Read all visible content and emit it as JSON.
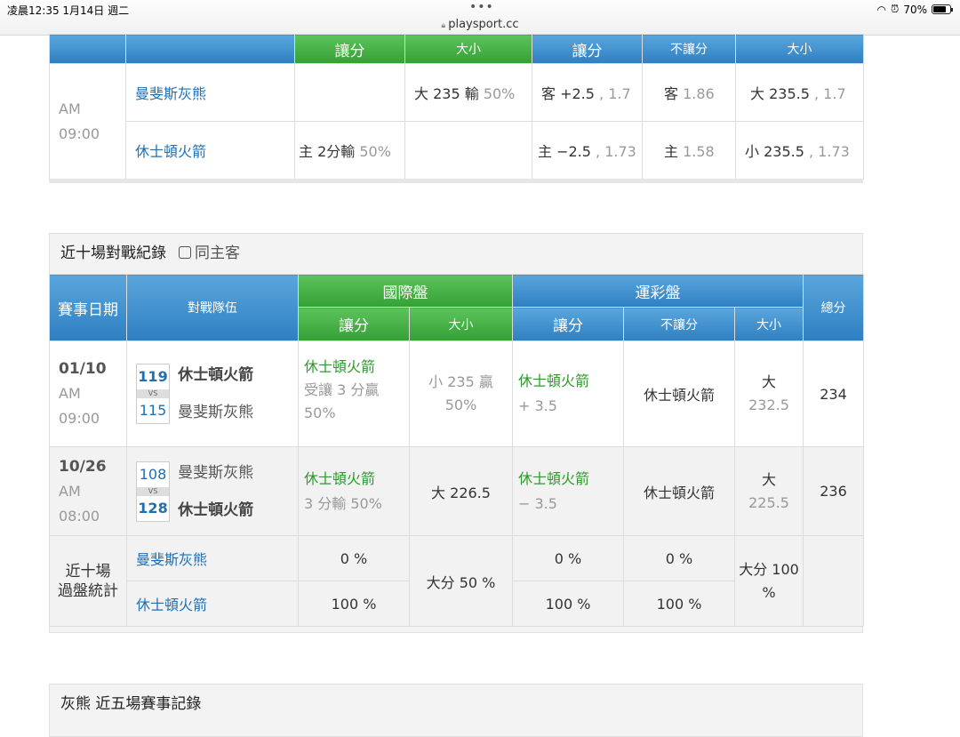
{
  "status": {
    "time": "凌晨12:35 1月14日 週二",
    "url": "playsport.cc",
    "battery": "70%",
    "dots": "•••"
  },
  "top_table": {
    "headers": {
      "intl_spread": "讓分",
      "intl_ou": "大小",
      "lot_spread": "讓分",
      "lot_nospread": "不讓分",
      "lot_ou": "大小"
    },
    "time": "AM 09:00",
    "rows": [
      {
        "team": "曼斐斯灰熊",
        "intl_spread": "",
        "intl_ou_main": "大 235 輸",
        "intl_ou_pct": "50%",
        "lot_spread_main": "客 +2.5",
        "lot_spread_odds": ", 1.7",
        "lot_nospread_main": "客",
        "lot_nospread_odds": "1.86",
        "lot_ou_main": "大 235.5",
        "lot_ou_odds": ", 1.7"
      },
      {
        "team": "休士頓火箭",
        "intl_spread_main": "主 2分輸",
        "intl_spread_pct": "50%",
        "intl_ou": "",
        "lot_spread_main": "主 −2.5",
        "lot_spread_odds": ", 1.73",
        "lot_nospread_main": "主",
        "lot_nospread_odds": "1.58",
        "lot_ou_main": "小 235.5",
        "lot_ou_odds": ", 1.73"
      }
    ]
  },
  "h2h": {
    "title": "近十場對戰紀錄",
    "same_home_label": "同主客",
    "headers": {
      "date": "賽事日期",
      "teams": "對戰隊伍",
      "intl": "國際盤",
      "lottery": "運彩盤",
      "total": "總分",
      "intl_spread": "讓分",
      "intl_ou": "大小",
      "lot_spread": "讓分",
      "lot_nospread": "不讓分",
      "lot_ou": "大小"
    },
    "games": [
      {
        "date": "01/10",
        "ampm": "AM",
        "time": "09:00",
        "vs": "VS",
        "top_score": "119",
        "top_team": "休士頓火箭",
        "bottom_score": "115",
        "bottom_team": "曼斐斯灰熊",
        "intl_spread_team": "休士頓火箭",
        "intl_spread_line1": "受讓 3 分贏",
        "intl_spread_line2": "50%",
        "intl_ou_line1": "小 235 贏",
        "intl_ou_line2": "50%",
        "lot_spread_team": "休士頓火箭",
        "lot_spread_val": "+ 3.5",
        "lot_nospread": "休士頓火箭",
        "lot_ou_dir": "大",
        "lot_ou_val": "232.5",
        "total": "234"
      },
      {
        "date": "10/26",
        "ampm": "AM",
        "time": "08:00",
        "vs": "VS",
        "top_score": "108",
        "top_team": "曼斐斯灰熊",
        "bottom_score": "128",
        "bottom_team": "休士頓火箭",
        "intl_spread_team": "休士頓火箭",
        "intl_spread_line1": "3 分輸 50%",
        "intl_spread_line2": "",
        "intl_ou_line1": "大 226.5",
        "intl_ou_line2": "",
        "lot_spread_team": "休士頓火箭",
        "lot_spread_val": "− 3.5",
        "lot_nospread": "休士頓火箭",
        "lot_ou_dir": "大",
        "lot_ou_val": "225.5",
        "total": "236"
      }
    ],
    "summary": {
      "label_line1": "近十場",
      "label_line2": "過盤統計",
      "team1": "曼斐斯灰熊",
      "team2": "休士頓火箭",
      "t1_intl_spread": "0 %",
      "t2_intl_spread": "100 %",
      "intl_ou": "大分 50 %",
      "t1_lot_spread": "0 %",
      "t2_lot_spread": "100 %",
      "t1_lot_nospread": "0 %",
      "t2_lot_nospread": "100 %",
      "lot_ou": "大分 100 %"
    }
  },
  "recent": {
    "title": "灰熊 近五場賽事記錄"
  }
}
